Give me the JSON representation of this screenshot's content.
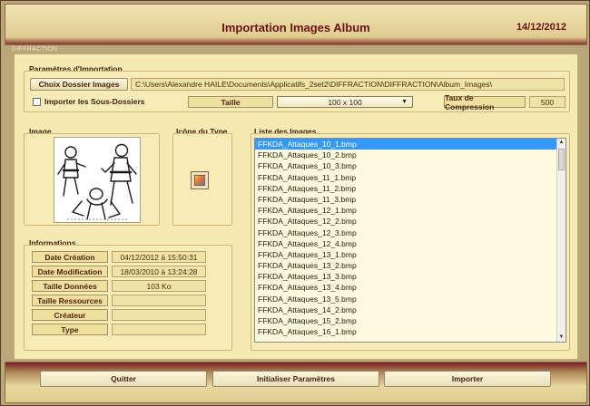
{
  "window": {
    "title": "Importation Images Album",
    "date": "14/12/2012",
    "section_tag": "DIFFRACTION"
  },
  "params": {
    "group_title": "Paramètres d'Importation",
    "choose_folder_label": "Choix Dossier Images",
    "folder_path": "C:\\Users\\Alexandre HAILE\\Documents\\Applicatifs_2set2\\DIFFRACTION\\DIFFRACTION\\Album_Images\\",
    "subfolders_label": "Importer les Sous-Dossiers",
    "size_label": "Taille",
    "size_value": "100 x 100",
    "compression_label": "Taux de Compression",
    "compression_value": "500"
  },
  "image_group": {
    "title": "Image"
  },
  "icon_group": {
    "title": "Icône du Type"
  },
  "list_group": {
    "title": "Liste des Images",
    "items": [
      "FFKDA_Attaques_10_1.bmp",
      "FFKDA_Attaques_10_2.bmp",
      "FFKDA_Attaques_10_3.bmp",
      "FFKDA_Attaques_11_1.bmp",
      "FFKDA_Attaques_11_2.bmp",
      "FFKDA_Attaques_11_3.bmp",
      "FFKDA_Attaques_12_1.bmp",
      "FFKDA_Attaques_12_2.bmp",
      "FFKDA_Attaques_12_3.bmp",
      "FFKDA_Attaques_12_4.bmp",
      "FFKDA_Attaques_13_1.bmp",
      "FFKDA_Attaques_13_2.bmp",
      "FFKDA_Attaques_13_3.bmp",
      "FFKDA_Attaques_13_4.bmp",
      "FFKDA_Attaques_13_5.bmp",
      "FFKDA_Attaques_14_2.bmp",
      "FFKDA_Attaques_15_2.bmp",
      "FFKDA_Attaques_16_1.bmp"
    ]
  },
  "info": {
    "title": "Informations",
    "rows": [
      {
        "label": "Date Création",
        "value": "04/12/2012 à 15:50:31"
      },
      {
        "label": "Date Modification",
        "value": "18/03/2010 à 13:24:28"
      },
      {
        "label": "Taille Données",
        "value": "103 Ko"
      },
      {
        "label": "Taille Ressources",
        "value": ""
      },
      {
        "label": "Créateur",
        "value": ""
      },
      {
        "label": "Type",
        "value": ""
      }
    ]
  },
  "footer": {
    "quit_label": "Quitter",
    "reset_label": "Initialiser Paramètres",
    "import_label": "Importer"
  }
}
